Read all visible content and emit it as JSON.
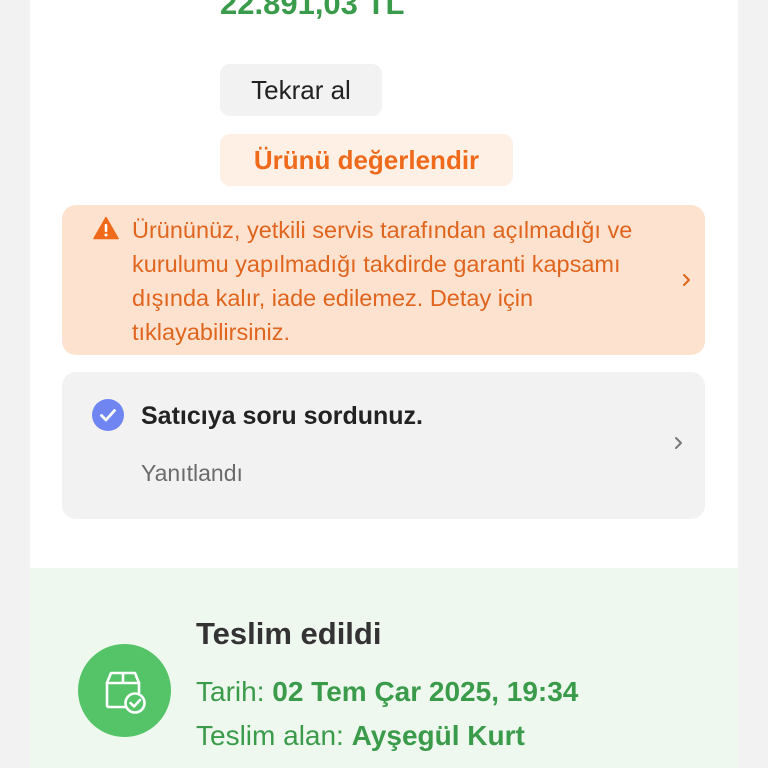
{
  "order": {
    "price": "22.891,03 TL",
    "reorder_label": "Tekrar al",
    "rate_label": "Ürünü değerlendir"
  },
  "warning": {
    "icon": "warning-icon",
    "text": "Ürününüz, yetkili servis tarafından açılmadığı ve kurulumu yapılmadığı takdirde garanti kapsamı dışında kalır, iade edilemez. Detay için tıklayabilirsiniz.",
    "chevron_icon": "chevron-right-icon"
  },
  "question": {
    "icon": "check-circle-icon",
    "title": "Satıcıya soru sordunuz.",
    "status": "Yanıtlandı",
    "chevron_icon": "chevron-right-icon"
  },
  "delivery": {
    "icon": "package-delivered-icon",
    "title": "Teslim edildi",
    "date_label": "Tarih:",
    "date_value": "02 Tem Çar 2025, 19:34",
    "receiver_label": "Teslim alan:",
    "receiver_value": "Ayşegül Kurt"
  },
  "colors": {
    "green": "#3a9b4a",
    "orange": "#ef6a1b",
    "warning_bg": "#fde3cf",
    "check_blue": "#6f86f2",
    "delivered_badge": "#55c468",
    "delivered_bg": "#eef8ef"
  }
}
